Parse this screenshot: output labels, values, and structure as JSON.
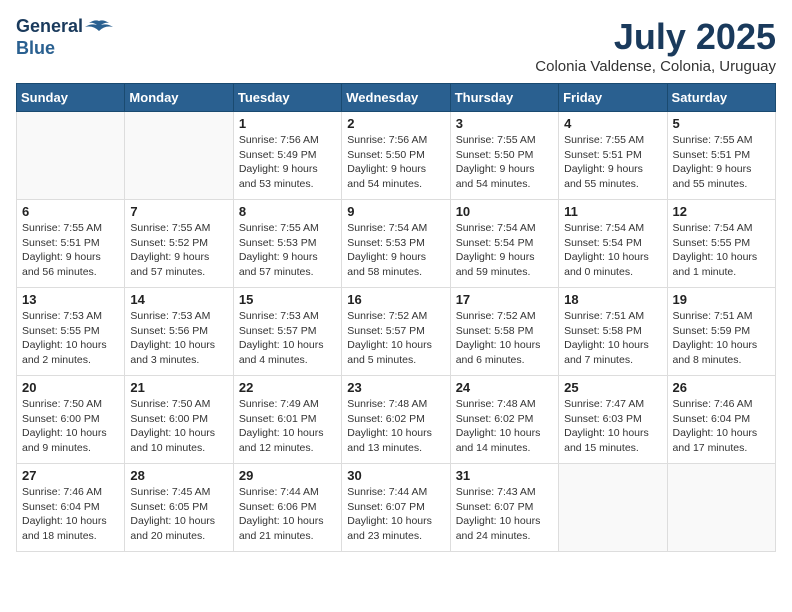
{
  "logo": {
    "line1": "General",
    "line2": "Blue"
  },
  "title": "July 2025",
  "subtitle": "Colonia Valdense, Colonia, Uruguay",
  "days_of_week": [
    "Sunday",
    "Monday",
    "Tuesday",
    "Wednesday",
    "Thursday",
    "Friday",
    "Saturday"
  ],
  "weeks": [
    [
      {
        "day": "",
        "info": ""
      },
      {
        "day": "",
        "info": ""
      },
      {
        "day": "1",
        "info": "Sunrise: 7:56 AM\nSunset: 5:49 PM\nDaylight: 9 hours and 53 minutes."
      },
      {
        "day": "2",
        "info": "Sunrise: 7:56 AM\nSunset: 5:50 PM\nDaylight: 9 hours and 54 minutes."
      },
      {
        "day": "3",
        "info": "Sunrise: 7:55 AM\nSunset: 5:50 PM\nDaylight: 9 hours and 54 minutes."
      },
      {
        "day": "4",
        "info": "Sunrise: 7:55 AM\nSunset: 5:51 PM\nDaylight: 9 hours and 55 minutes."
      },
      {
        "day": "5",
        "info": "Sunrise: 7:55 AM\nSunset: 5:51 PM\nDaylight: 9 hours and 55 minutes."
      }
    ],
    [
      {
        "day": "6",
        "info": "Sunrise: 7:55 AM\nSunset: 5:51 PM\nDaylight: 9 hours and 56 minutes."
      },
      {
        "day": "7",
        "info": "Sunrise: 7:55 AM\nSunset: 5:52 PM\nDaylight: 9 hours and 57 minutes."
      },
      {
        "day": "8",
        "info": "Sunrise: 7:55 AM\nSunset: 5:53 PM\nDaylight: 9 hours and 57 minutes."
      },
      {
        "day": "9",
        "info": "Sunrise: 7:54 AM\nSunset: 5:53 PM\nDaylight: 9 hours and 58 minutes."
      },
      {
        "day": "10",
        "info": "Sunrise: 7:54 AM\nSunset: 5:54 PM\nDaylight: 9 hours and 59 minutes."
      },
      {
        "day": "11",
        "info": "Sunrise: 7:54 AM\nSunset: 5:54 PM\nDaylight: 10 hours and 0 minutes."
      },
      {
        "day": "12",
        "info": "Sunrise: 7:54 AM\nSunset: 5:55 PM\nDaylight: 10 hours and 1 minute."
      }
    ],
    [
      {
        "day": "13",
        "info": "Sunrise: 7:53 AM\nSunset: 5:55 PM\nDaylight: 10 hours and 2 minutes."
      },
      {
        "day": "14",
        "info": "Sunrise: 7:53 AM\nSunset: 5:56 PM\nDaylight: 10 hours and 3 minutes."
      },
      {
        "day": "15",
        "info": "Sunrise: 7:53 AM\nSunset: 5:57 PM\nDaylight: 10 hours and 4 minutes."
      },
      {
        "day": "16",
        "info": "Sunrise: 7:52 AM\nSunset: 5:57 PM\nDaylight: 10 hours and 5 minutes."
      },
      {
        "day": "17",
        "info": "Sunrise: 7:52 AM\nSunset: 5:58 PM\nDaylight: 10 hours and 6 minutes."
      },
      {
        "day": "18",
        "info": "Sunrise: 7:51 AM\nSunset: 5:58 PM\nDaylight: 10 hours and 7 minutes."
      },
      {
        "day": "19",
        "info": "Sunrise: 7:51 AM\nSunset: 5:59 PM\nDaylight: 10 hours and 8 minutes."
      }
    ],
    [
      {
        "day": "20",
        "info": "Sunrise: 7:50 AM\nSunset: 6:00 PM\nDaylight: 10 hours and 9 minutes."
      },
      {
        "day": "21",
        "info": "Sunrise: 7:50 AM\nSunset: 6:00 PM\nDaylight: 10 hours and 10 minutes."
      },
      {
        "day": "22",
        "info": "Sunrise: 7:49 AM\nSunset: 6:01 PM\nDaylight: 10 hours and 12 minutes."
      },
      {
        "day": "23",
        "info": "Sunrise: 7:48 AM\nSunset: 6:02 PM\nDaylight: 10 hours and 13 minutes."
      },
      {
        "day": "24",
        "info": "Sunrise: 7:48 AM\nSunset: 6:02 PM\nDaylight: 10 hours and 14 minutes."
      },
      {
        "day": "25",
        "info": "Sunrise: 7:47 AM\nSunset: 6:03 PM\nDaylight: 10 hours and 15 minutes."
      },
      {
        "day": "26",
        "info": "Sunrise: 7:46 AM\nSunset: 6:04 PM\nDaylight: 10 hours and 17 minutes."
      }
    ],
    [
      {
        "day": "27",
        "info": "Sunrise: 7:46 AM\nSunset: 6:04 PM\nDaylight: 10 hours and 18 minutes."
      },
      {
        "day": "28",
        "info": "Sunrise: 7:45 AM\nSunset: 6:05 PM\nDaylight: 10 hours and 20 minutes."
      },
      {
        "day": "29",
        "info": "Sunrise: 7:44 AM\nSunset: 6:06 PM\nDaylight: 10 hours and 21 minutes."
      },
      {
        "day": "30",
        "info": "Sunrise: 7:44 AM\nSunset: 6:07 PM\nDaylight: 10 hours and 23 minutes."
      },
      {
        "day": "31",
        "info": "Sunrise: 7:43 AM\nSunset: 6:07 PM\nDaylight: 10 hours and 24 minutes."
      },
      {
        "day": "",
        "info": ""
      },
      {
        "day": "",
        "info": ""
      }
    ]
  ]
}
